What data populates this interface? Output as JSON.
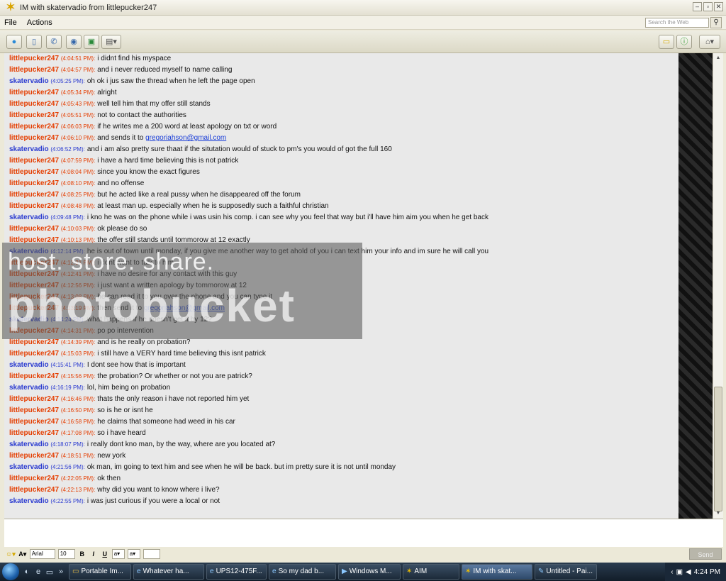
{
  "window": {
    "title": "IM with skatervadio from littlepucker247",
    "app_icon": "aim-running-man-icon"
  },
  "menu": {
    "items": [
      "File",
      "Actions"
    ]
  },
  "search": {
    "placeholder": "Search the Web"
  },
  "messages": [
    {
      "sender": "littlepucker247",
      "time": "(4:04:51 PM):",
      "text": "i didnt find his myspace",
      "side": "lp"
    },
    {
      "sender": "littlepucker247",
      "time": "(4:04:57 PM):",
      "text": "and i never reduced myself to name calling",
      "side": "lp"
    },
    {
      "sender": "skatervadio",
      "time": "(4:05:25 PM):",
      "text": "oh ok i jus saw the thread when he left the page open",
      "side": "sk"
    },
    {
      "sender": "littlepucker247",
      "time": "(4:05:34 PM):",
      "text": "alright",
      "side": "lp"
    },
    {
      "sender": "littlepucker247",
      "time": "(4:05:43 PM):",
      "text": "well tell him that my offer still stands",
      "side": "lp"
    },
    {
      "sender": "littlepucker247",
      "time": "(4:05:51 PM):",
      "text": "not to contact the authorities",
      "side": "lp"
    },
    {
      "sender": "littlepucker247",
      "time": "(4:06:03 PM):",
      "text": "if he writes me a 200 word at least apology on txt or word",
      "side": "lp"
    },
    {
      "sender": "littlepucker247",
      "time": "(4:06:10 PM):",
      "text": "and sends it to",
      "link": "gregoriahson@gmail.com",
      "side": "lp"
    },
    {
      "sender": "skatervadio",
      "time": "(4:06:52 PM):",
      "text": "and i am also pretty sure thaat if the situtation would of stuck to pm's you would of got the full 160",
      "side": "sk"
    },
    {
      "sender": "littlepucker247",
      "time": "(4:07:59 PM):",
      "text": "i have a hard time believing this is not patrick",
      "side": "lp"
    },
    {
      "sender": "littlepucker247",
      "time": "(4:08:04 PM):",
      "text": "since you know the exact figures",
      "side": "lp"
    },
    {
      "sender": "littlepucker247",
      "time": "(4:08:10 PM):",
      "text": "and no offense",
      "side": "lp"
    },
    {
      "sender": "littlepucker247",
      "time": "(4:08:25 PM):",
      "text": "but he acted like a real pussy when he disappeared off the forum",
      "side": "lp"
    },
    {
      "sender": "littlepucker247",
      "time": "(4:08:48 PM):",
      "text": "at least man up. especially when he is supposedly such a faithful christian",
      "side": "lp"
    },
    {
      "sender": "skatervadio",
      "time": "(4:09:48 PM):",
      "text": "i kno he was on the phone while i was usin his comp. i can see why you feel that way but i'll have him aim you when he get back",
      "side": "sk"
    },
    {
      "sender": "littlepucker247",
      "time": "(4:10:03 PM):",
      "text": "ok please do so",
      "side": "lp"
    },
    {
      "sender": "littlepucker247",
      "time": "(4:10:13 PM):",
      "text": "the offer still stands until tommorow at 12 exactly",
      "side": "lp"
    },
    {
      "sender": "skatervadio",
      "time": "(4:12:14 PM):",
      "text": "he is out of town until monday, if you give me another way to get ahold of you i can text him your info and im sure he will call you",
      "side": "sk"
    },
    {
      "sender": "littlepucker247",
      "time": "(4:12:31 PM):",
      "text": "i dont want to talk to him",
      "side": "lp"
    },
    {
      "sender": "littlepucker247",
      "time": "(4:12:41 PM):",
      "text": "i have no desire for any contact with this guy",
      "side": "lp"
    },
    {
      "sender": "littlepucker247",
      "time": "(4:12:56 PM):",
      "text": "i just want a written apology by tommorow at 12",
      "side": "lp"
    },
    {
      "sender": "littlepucker247",
      "time": "(4:13:08 PM):",
      "text": "he can read it to you over the phone and you can type it",
      "side": "lp"
    },
    {
      "sender": "littlepucker247",
      "time": "(4:13:19 PM):",
      "text": "then send it to",
      "link": "gregoriahson@gmail.com",
      "side": "lp"
    },
    {
      "sender": "skatervadio",
      "time": "(4:14:24 PM):",
      "text": "what happens if he doesn't get it by 12?",
      "side": "sk"
    },
    {
      "sender": "littlepucker247",
      "time": "(4:14:31 PM):",
      "text": "po po intervention",
      "side": "lp"
    },
    {
      "sender": "littlepucker247",
      "time": "(4:14:39 PM):",
      "text": "and is he really on probation?",
      "side": "lp"
    },
    {
      "sender": "littlepucker247",
      "time": "(4:15:03 PM):",
      "text": "i still have a VERY hard time believing this isnt patrick",
      "side": "lp"
    },
    {
      "sender": "skatervadio",
      "time": "(4:15:41 PM):",
      "text": "I dont see how that is important",
      "side": "sk"
    },
    {
      "sender": "littlepucker247",
      "time": "(4:15:56 PM):",
      "text": "the probation? Or whether or not you are patrick?",
      "side": "lp"
    },
    {
      "sender": "skatervadio",
      "time": "(4:16:19 PM):",
      "text": "lol, him being on probation",
      "side": "sk"
    },
    {
      "sender": "littlepucker247",
      "time": "(4:16:46 PM):",
      "text": "thats the only reason i have not reported him yet",
      "side": "lp"
    },
    {
      "sender": "littlepucker247",
      "time": "(4:16:50 PM):",
      "text": "so is he or isnt he",
      "side": "lp"
    },
    {
      "sender": "littlepucker247",
      "time": "(4:16:58 PM):",
      "text": "he claims that someone had weed in his car",
      "side": "lp"
    },
    {
      "sender": "littlepucker247",
      "time": "(4:17:08 PM):",
      "text": "so i have heard",
      "side": "lp"
    },
    {
      "sender": "skatervadio",
      "time": "(4:18:07 PM):",
      "text": "i really dont kno man, by the way, where are you located at?",
      "side": "sk"
    },
    {
      "sender": "littlepucker247",
      "time": "(4:18:51 PM):",
      "text": "new york",
      "side": "lp"
    },
    {
      "sender": "skatervadio",
      "time": "(4:21:56 PM):",
      "text": "ok man, im going to text him and see when he will be back. but im pretty sure it is not until monday",
      "side": "sk"
    },
    {
      "sender": "littlepucker247",
      "time": "(4:22:05 PM):",
      "text": "ok then",
      "side": "lp"
    },
    {
      "sender": "littlepucker247",
      "time": "(4:22:13 PM):",
      "text": "why did you want to know where i live?",
      "side": "lp"
    },
    {
      "sender": "skatervadio",
      "time": "(4:22:55 PM):",
      "text": "i was just curious if you were a local or not",
      "side": "sk"
    }
  ],
  "format": {
    "font": "Arial",
    "size": "10",
    "bold": "B",
    "italic": "I",
    "underline": "U",
    "send_label": "Send"
  },
  "taskbar": {
    "tasks": [
      {
        "label": "Portable Im...",
        "icon": "folder-icon"
      },
      {
        "label": "Whatever ha...",
        "icon": "ie-icon"
      },
      {
        "label": "UPS12-475F...",
        "icon": "ie-icon"
      },
      {
        "label": "So my dad b...",
        "icon": "ie-icon"
      },
      {
        "label": "Windows M...",
        "icon": "media-player-icon"
      },
      {
        "label": "AIM",
        "icon": "aim-icon"
      },
      {
        "label": "IM with skat...",
        "icon": "aim-icon",
        "active": true
      },
      {
        "label": "Untitled - Pai...",
        "icon": "paint-icon"
      }
    ],
    "clock": "4:24 PM"
  },
  "watermark": {
    "line1": "host. store. share.",
    "line2": "photobucket"
  }
}
